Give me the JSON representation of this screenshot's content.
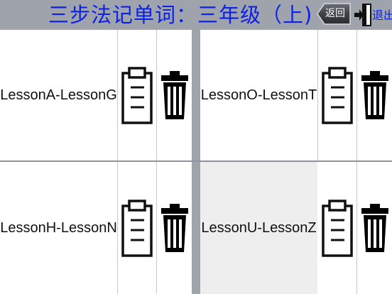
{
  "header": {
    "title": "三步法记单词：三年级（上)",
    "back_label": "返回",
    "exit_label": "退出"
  },
  "lessons": [
    {
      "label": "LessonA-LessonG",
      "selected": false
    },
    {
      "label": "LessonO-LessonT",
      "selected": false
    },
    {
      "label": "LessonH-LessonN",
      "selected": false
    },
    {
      "label": "LessonU-LessonZ",
      "selected": true
    }
  ],
  "icons": {
    "clipboard": "clipboard-icon",
    "trash": "trash-icon",
    "exit": "exit-door-icon"
  },
  "colors": {
    "title": "#0d20e6",
    "background": "#9fa3ab",
    "cell": "#ffffff",
    "selected_cell": "#eeeeee"
  }
}
